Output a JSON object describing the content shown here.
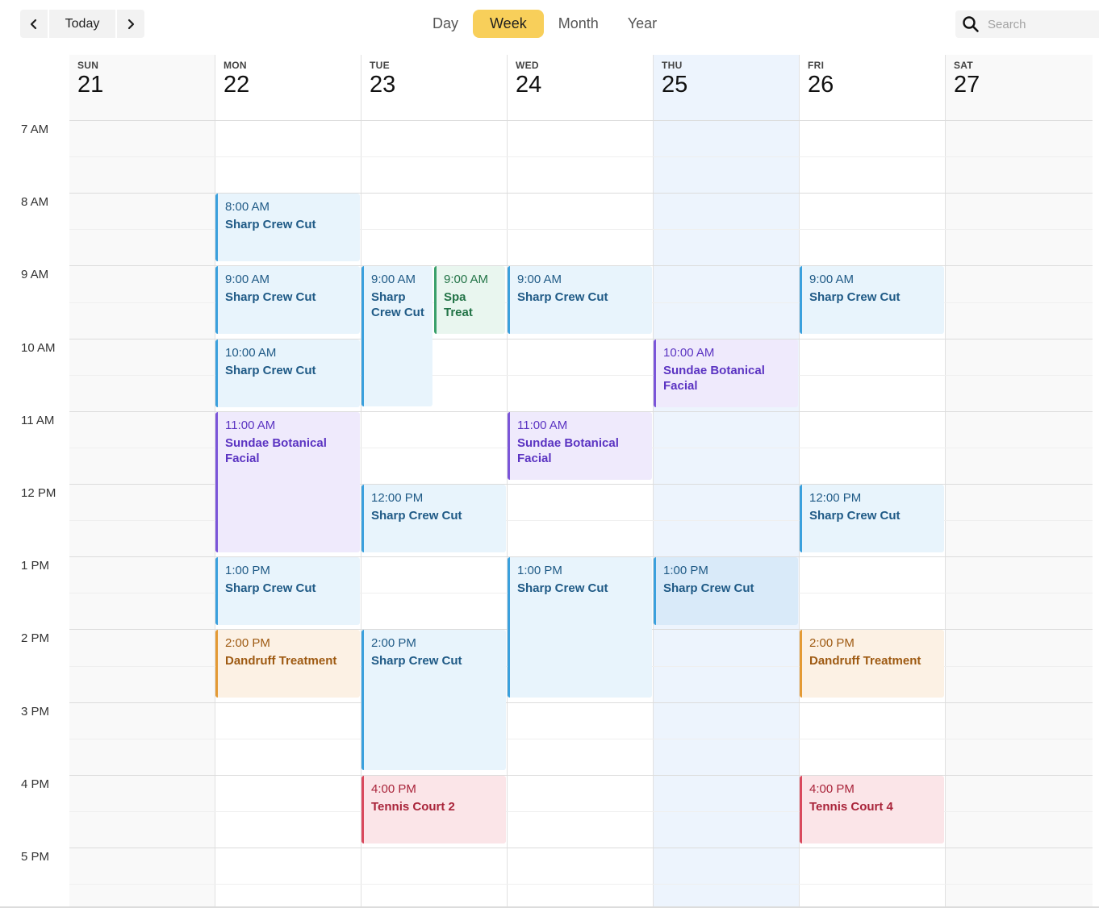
{
  "toolbar": {
    "prev_icon": "chevron-left-icon",
    "today_label": "Today",
    "next_icon": "chevron-right-icon",
    "views": [
      "Day",
      "Week",
      "Month",
      "Year"
    ],
    "active_view": "Week",
    "search_placeholder": "Search",
    "search_icon": "search-icon"
  },
  "days": [
    {
      "dow": "SUN",
      "num": "21"
    },
    {
      "dow": "MON",
      "num": "22"
    },
    {
      "dow": "TUE",
      "num": "23"
    },
    {
      "dow": "WED",
      "num": "24"
    },
    {
      "dow": "THU",
      "num": "25"
    },
    {
      "dow": "FRI",
      "num": "26"
    },
    {
      "dow": "SAT",
      "num": "27"
    }
  ],
  "today_index": 4,
  "weekend_indices": [
    0,
    6
  ],
  "hours": [
    "7 AM",
    "8 AM",
    "9 AM",
    "10 AM",
    "11 AM",
    "12 PM",
    "1 PM",
    "2 PM",
    "3 PM",
    "4 PM",
    "5 PM"
  ],
  "colors": {
    "accent": "#f8cf5a",
    "blue": "#3aa0dd",
    "purple": "#7b55d9",
    "green": "#3aa06b",
    "orange": "#e49a34",
    "red": "#d9495d",
    "today_bg": "#edf4fd"
  },
  "events": [
    {
      "day": 1,
      "start": 8,
      "end": 9,
      "time": "8:00 AM",
      "title": "Sharp Crew Cut",
      "color": "blue"
    },
    {
      "day": 1,
      "start": 9,
      "end": 10,
      "time": "9:00 AM",
      "title": "Sharp Crew Cut",
      "color": "blue"
    },
    {
      "day": 1,
      "start": 10,
      "end": 11,
      "time": "10:00 AM",
      "title": "Sharp Crew Cut",
      "color": "blue"
    },
    {
      "day": 1,
      "start": 11,
      "end": 13,
      "time": "11:00 AM",
      "title": "Sundae Botanical Facial",
      "color": "purple"
    },
    {
      "day": 1,
      "start": 13,
      "end": 14,
      "time": "1:00 PM",
      "title": "Sharp Crew Cut",
      "color": "blue"
    },
    {
      "day": 1,
      "start": 14,
      "end": 15,
      "time": "2:00 PM",
      "title": "Dandruff Treatment",
      "color": "orange"
    },
    {
      "day": 2,
      "start": 9,
      "end": 11,
      "time": "9:00 AM",
      "title": "Sharp Crew Cut",
      "color": "blue",
      "part": "left"
    },
    {
      "day": 2,
      "start": 9,
      "end": 10,
      "time": "9:00 AM",
      "title": "Spa Treat",
      "color": "green",
      "part": "right"
    },
    {
      "day": 2,
      "start": 12,
      "end": 13,
      "time": "12:00 PM",
      "title": "Sharp Crew Cut",
      "color": "blue"
    },
    {
      "day": 2,
      "start": 14,
      "end": 16,
      "time": "2:00 PM",
      "title": "Sharp Crew Cut",
      "color": "blue"
    },
    {
      "day": 2,
      "start": 16,
      "end": 17,
      "time": "4:00 PM",
      "title": "Tennis Court 2",
      "color": "red"
    },
    {
      "day": 3,
      "start": 9,
      "end": 10,
      "time": "9:00 AM",
      "title": "Sharp Crew Cut",
      "color": "blue"
    },
    {
      "day": 3,
      "start": 11,
      "end": 12,
      "time": "11:00 AM",
      "title": "Sundae Botanical Facial",
      "color": "purple"
    },
    {
      "day": 3,
      "start": 13,
      "end": 15,
      "time": "1:00 PM",
      "title": "Sharp Crew Cut",
      "color": "blue"
    },
    {
      "day": 4,
      "start": 10,
      "end": 11,
      "time": "10:00 AM",
      "title": "Sundae Botanical Facial",
      "color": "purple"
    },
    {
      "day": 4,
      "start": 13,
      "end": 14,
      "time": "1:00 PM",
      "title": "Sharp Crew Cut",
      "color": "blue-dark"
    },
    {
      "day": 5,
      "start": 9,
      "end": 10,
      "time": "9:00 AM",
      "title": "Sharp Crew Cut",
      "color": "blue"
    },
    {
      "day": 5,
      "start": 12,
      "end": 13,
      "time": "12:00 PM",
      "title": "Sharp Crew Cut",
      "color": "blue"
    },
    {
      "day": 5,
      "start": 14,
      "end": 15,
      "time": "2:00 PM",
      "title": "Dandruff Treatment",
      "color": "orange"
    },
    {
      "day": 5,
      "start": 16,
      "end": 17,
      "time": "4:00 PM",
      "title": "Tennis Court 4",
      "color": "red"
    }
  ]
}
